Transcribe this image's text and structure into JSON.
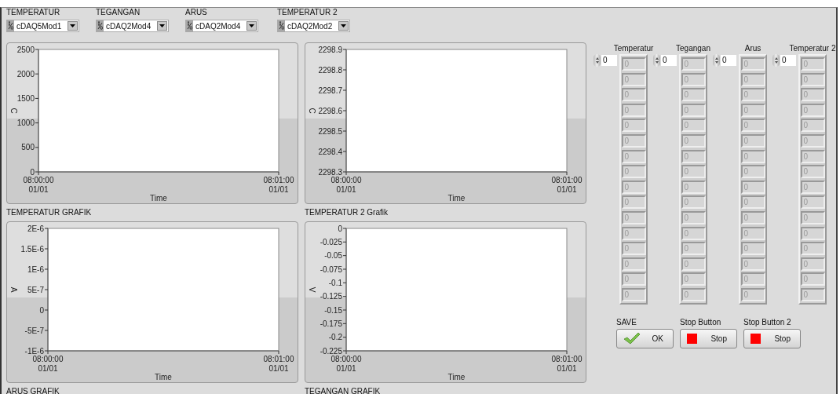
{
  "selectors": [
    {
      "label": "TEMPERATUR",
      "value": "cDAQ5Mod1"
    },
    {
      "label": "TEGANGAN",
      "value": "cDAQ2Mod4"
    },
    {
      "label": "ARUS",
      "value": "cDAQ2Mod4"
    },
    {
      "label": "TEMPERATUR 2",
      "value": "cDAQ2Mod2"
    }
  ],
  "charts": [
    {
      "caption": "TEMPERATUR GRAFIK",
      "chart_data": {
        "type": "line",
        "xlabel": "Time",
        "ylabel": "C",
        "ylim": [
          0,
          2500
        ],
        "yticks": [
          {
            "value": 2500,
            "label": "2500"
          },
          {
            "value": 2000,
            "label": "2000"
          },
          {
            "value": 1500,
            "label": "1500"
          },
          {
            "value": 1000,
            "label": "1000"
          },
          {
            "value": 500,
            "label": "500"
          },
          {
            "value": 0,
            "label": "0"
          }
        ],
        "categories": [
          "08:00:00\n01/01",
          "08:01:00\n01/01"
        ]
      }
    },
    {
      "caption": "TEMPERATUR 2 Grafik",
      "chart_data": {
        "type": "line",
        "xlabel": "Time",
        "ylabel": "C",
        "ylim": [
          2298.3,
          2298.9
        ],
        "yticks": [
          {
            "value": 2298.9,
            "label": "2298.9"
          },
          {
            "value": 2298.8,
            "label": "2298.8"
          },
          {
            "value": 2298.7,
            "label": "2298.7"
          },
          {
            "value": 2298.6,
            "label": "2298.6"
          },
          {
            "value": 2298.5,
            "label": "2298.5"
          },
          {
            "value": 2298.4,
            "label": "2298.4"
          },
          {
            "value": 2298.3,
            "label": "2298.3"
          }
        ],
        "categories": [
          "08:00:00\n01/01",
          "08:01:00\n01/01"
        ]
      }
    },
    {
      "caption": "ARUS GRAFIK",
      "chart_data": {
        "type": "line",
        "xlabel": "Time",
        "ylabel": "A",
        "ylim": [
          -1e-06,
          2e-06
        ],
        "yticks": [
          {
            "value": 2e-06,
            "label": "2E-6"
          },
          {
            "value": 1.5e-06,
            "label": "1.5E-6"
          },
          {
            "value": 1e-06,
            "label": "1E-6"
          },
          {
            "value": 5e-07,
            "label": "5E-7"
          },
          {
            "value": 0,
            "label": "0"
          },
          {
            "value": -5e-07,
            "label": "-5E-7"
          },
          {
            "value": -1e-06,
            "label": "-1E-6"
          }
        ],
        "categories": [
          "08:00:00\n01/01",
          "08:01:00\n01/01"
        ]
      }
    },
    {
      "caption": "TEGANGAN GRAFIK",
      "chart_data": {
        "type": "line",
        "xlabel": "Time",
        "ylabel": "V",
        "ylim": [
          -0.225,
          0
        ],
        "yticks": [
          {
            "value": 0,
            "label": "0"
          },
          {
            "value": -0.025,
            "label": "-0.025"
          },
          {
            "value": -0.05,
            "label": "-0.05"
          },
          {
            "value": -0.075,
            "label": "-0.075"
          },
          {
            "value": -0.1,
            "label": "-0.1"
          },
          {
            "value": -0.125,
            "label": "-0.125"
          },
          {
            "value": -0.15,
            "label": "-0.15"
          },
          {
            "value": -0.175,
            "label": "-0.175"
          },
          {
            "value": -0.2,
            "label": "-0.2"
          },
          {
            "value": -0.225,
            "label": "-0.225"
          }
        ],
        "categories": [
          "08:00:00\n01/01",
          "08:01:00\n01/01"
        ]
      }
    }
  ],
  "arrays": [
    {
      "label": "Temperatur",
      "index": "0",
      "disabled": true,
      "values": [
        "0",
        "0",
        "0",
        "0",
        "0",
        "0",
        "0",
        "0",
        "0",
        "0",
        "0",
        "0",
        "0",
        "0",
        "0",
        "0"
      ]
    },
    {
      "label": "Tegangan",
      "index": "0",
      "disabled": true,
      "values": [
        "0",
        "0",
        "0",
        "0",
        "0",
        "0",
        "0",
        "0",
        "0",
        "0",
        "0",
        "0",
        "0",
        "0",
        "0",
        "0"
      ]
    },
    {
      "label": "Arus",
      "index": "0",
      "disabled": true,
      "values": [
        "0",
        "0",
        "0",
        "0",
        "0",
        "0",
        "0",
        "0",
        "0",
        "0",
        "0",
        "0",
        "0",
        "0",
        "0",
        "0"
      ]
    },
    {
      "label": "Temperatur 2",
      "index": "0",
      "disabled": true,
      "values": [
        "0",
        "0",
        "0",
        "0",
        "0",
        "0",
        "0",
        "0",
        "0",
        "0",
        "0",
        "0",
        "0",
        "0",
        "0",
        "0"
      ]
    }
  ],
  "buttons": [
    {
      "label": "SAVE",
      "text": "OK",
      "kind": "ok"
    },
    {
      "label": "Stop Button",
      "text": "Stop",
      "kind": "stop"
    },
    {
      "label": "Stop Button 2",
      "text": "Stop",
      "kind": "stop"
    }
  ]
}
